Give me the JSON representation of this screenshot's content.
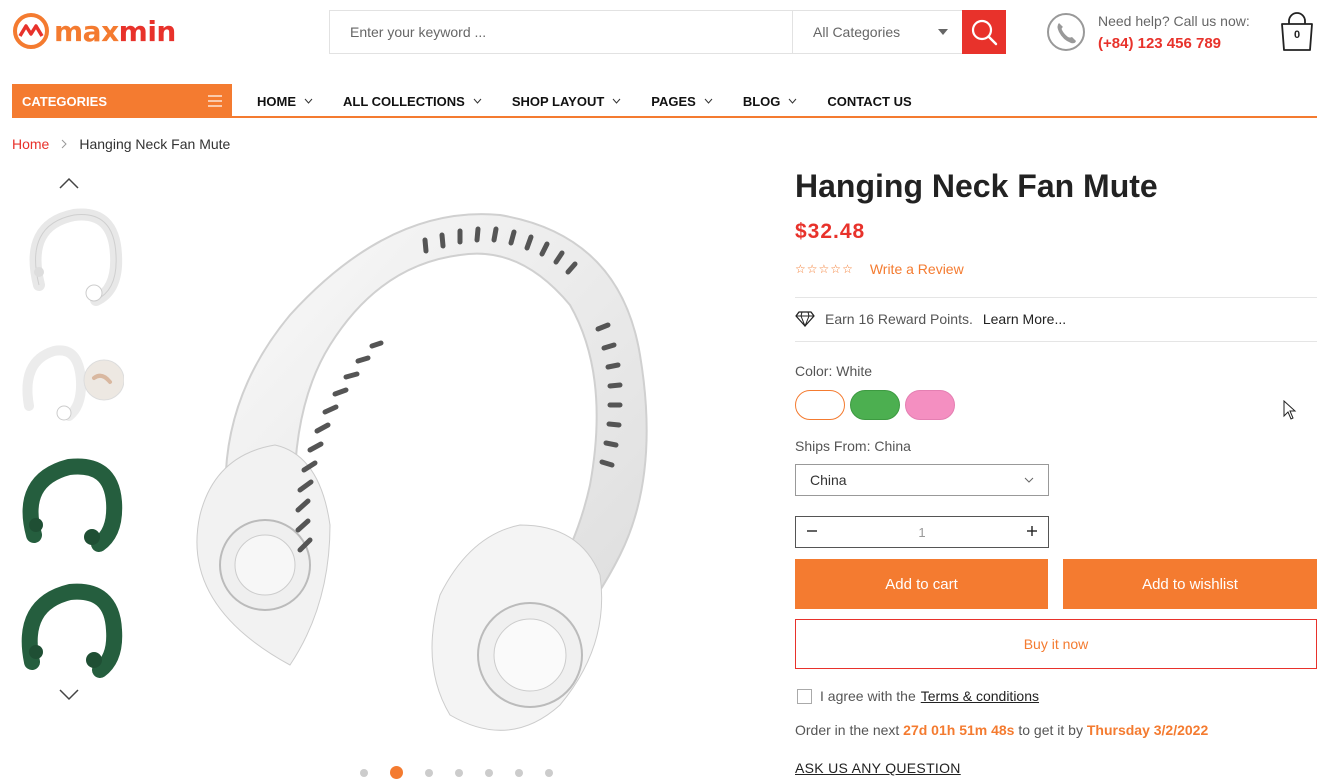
{
  "brand": {
    "part1": "max",
    "part2": "min"
  },
  "search": {
    "placeholder": "Enter your keyword ...",
    "category": "All Categories"
  },
  "help": {
    "line1": "Need help? Call us now:",
    "phone": "(+84) 123 456 789"
  },
  "cart": {
    "count": "0"
  },
  "nav": {
    "categories_label": "CATEGORIES",
    "items": [
      {
        "label": "HOME"
      },
      {
        "label": "ALL COLLECTIONS"
      },
      {
        "label": "SHOP LAYOUT"
      },
      {
        "label": "PAGES"
      },
      {
        "label": "BLOG"
      },
      {
        "label": "CONTACT US"
      }
    ]
  },
  "breadcrumb": {
    "home": "Home",
    "current": "Hanging Neck Fan Mute"
  },
  "product": {
    "title": "Hanging Neck Fan Mute",
    "price": "$32.48",
    "review_link": "Write a Review",
    "reward_text": "Earn 16 Reward Points.",
    "reward_more": "Learn More...",
    "color_label": "Color: White",
    "colors": [
      "#ffffff",
      "#4caf50",
      "#f48fc1"
    ],
    "ships_label": "Ships From: China",
    "ships_value": "China",
    "quantity": "1",
    "add_to_cart": "Add to cart",
    "add_to_wishlist": "Add to wishlist",
    "buy_now": "Buy it now",
    "agree_text": "I agree with the",
    "terms": "Terms & conditions",
    "order_prefix": "Order in the next",
    "countdown": "27d 01h 51m 48s",
    "order_mid": "to get it by",
    "delivery_date": "Thursday 3/2/2022",
    "ask": "ASK US ANY QUESTION"
  },
  "gallery": {
    "active_dot": 1,
    "dot_count": 7
  },
  "colors": {
    "accent": "#f47b30",
    "red": "#e8322b"
  }
}
